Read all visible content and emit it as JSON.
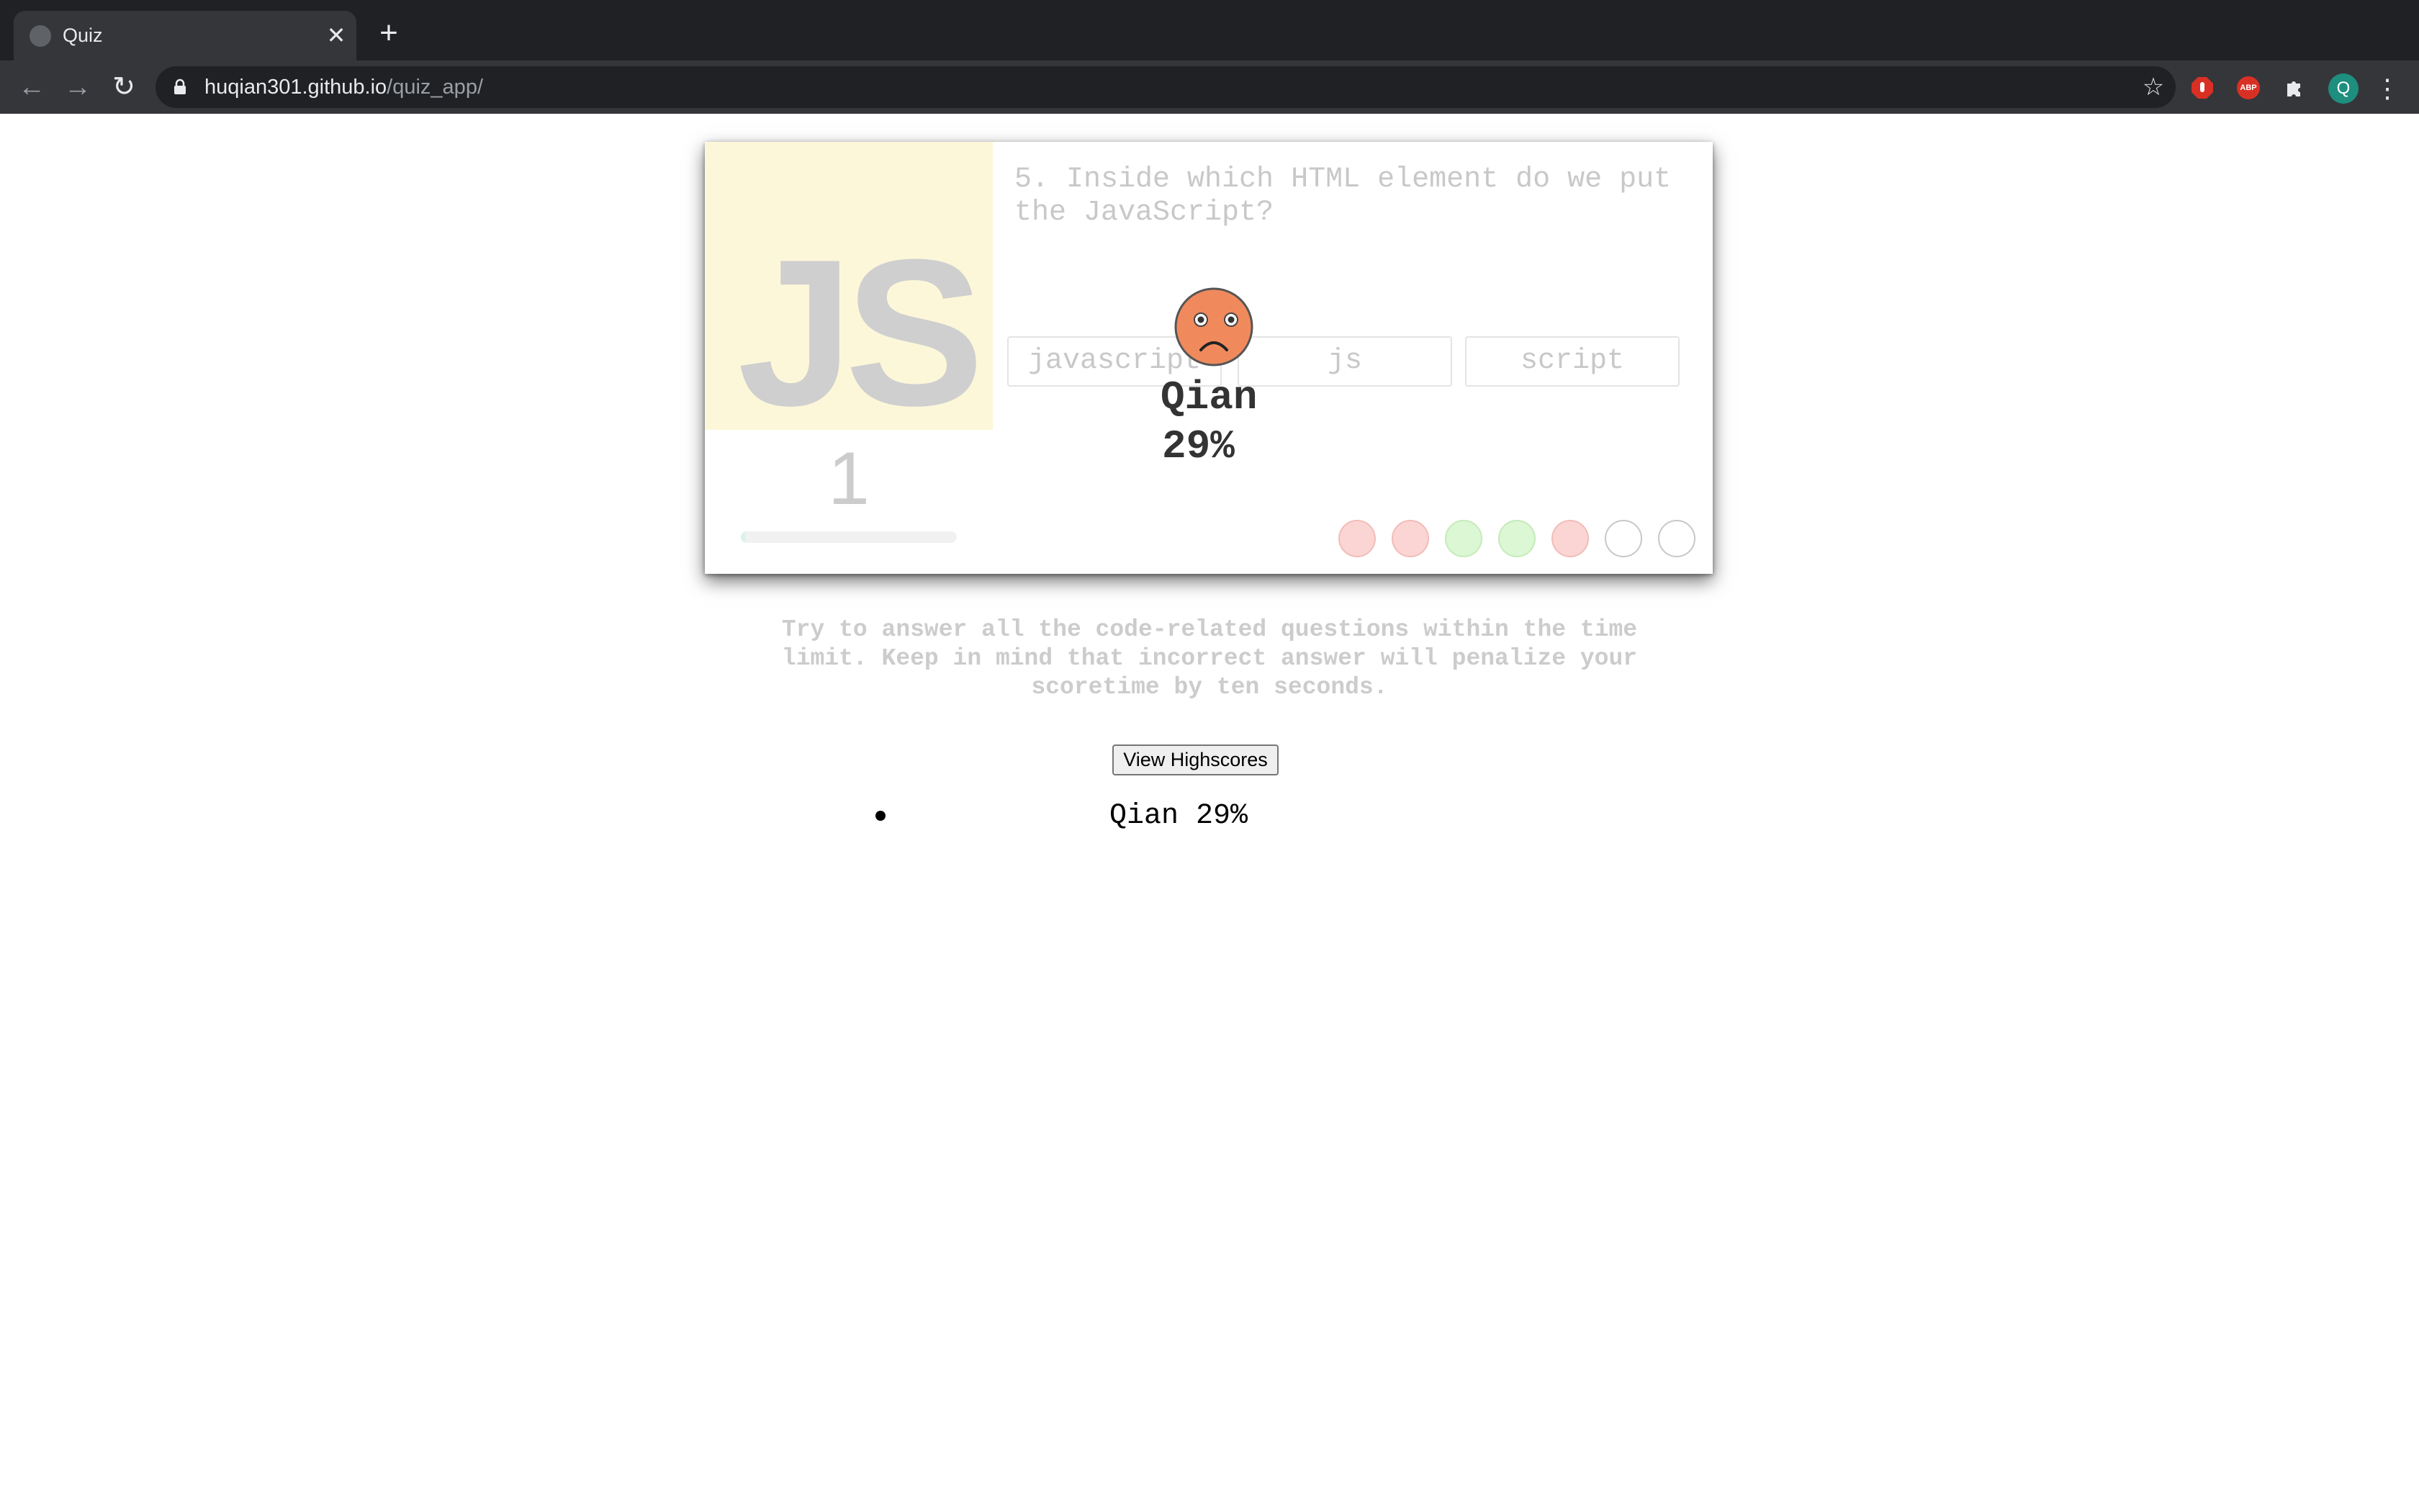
{
  "browser": {
    "tab_title": "Quiz",
    "tab_close": "✕",
    "new_tab": "+",
    "url_host": "huqian301.github.io",
    "url_path": "/quiz_app/",
    "back": "←",
    "forward": "→",
    "reload": "↻",
    "bookmark": "☆",
    "extensions": [
      "adblock-icon",
      "abp-icon",
      "puzzle-icon"
    ],
    "abp_label": "ABP",
    "profile_initial": "Q",
    "menu": "⋮"
  },
  "quiz": {
    "logo_text": "JS",
    "question": "5. Inside which HTML element do we put the JavaScript?",
    "answers": [
      "javascript",
      "js",
      "script"
    ],
    "timer_value": "1",
    "timer_fraction": 0.02,
    "progress": [
      "wrong",
      "wrong",
      "correct",
      "correct",
      "wrong",
      "pending",
      "pending"
    ],
    "colors": {
      "wrong": "#fbd5d3",
      "correct": "#dcf7d4",
      "pending": "#ffffff",
      "face": "#f08a5d"
    }
  },
  "result_overlay": {
    "face": "sad-face-icon",
    "name": "Qian",
    "percent": "29%"
  },
  "instructions": "Try to answer all the code-related questions within the time limit. Keep in mind that incorrect answer will penalize your scoretime by ten seconds.",
  "highscores": {
    "button_label": "View Highscores",
    "entries": [
      "Qian 29%"
    ]
  }
}
